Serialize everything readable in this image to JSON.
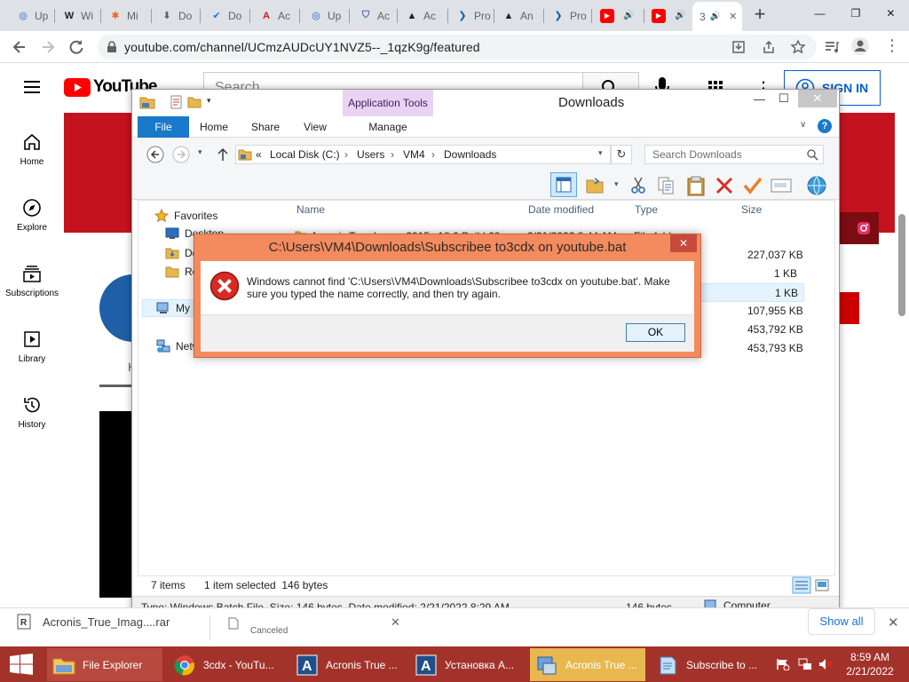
{
  "chrome": {
    "tabs": [
      {
        "label": "Up",
        "icon": "upwork-icon",
        "color": "#1f57c3",
        "glyph": "◎"
      },
      {
        "label": "Wi",
        "icon": "wikipedia-icon",
        "color": "#202124",
        "glyph": "W"
      },
      {
        "label": "Mi",
        "icon": "joomla-icon",
        "color": "#f26522",
        "glyph": "✱"
      },
      {
        "label": "Do",
        "icon": "download-icon",
        "color": "#5f6368",
        "glyph": "⬇"
      },
      {
        "label": "Do",
        "icon": "check-icon",
        "color": "#1a73e8",
        "glyph": "✔"
      },
      {
        "label": "Ac",
        "icon": "acrobat-icon",
        "color": "#e0161d",
        "glyph": "A"
      },
      {
        "label": "Up",
        "icon": "upwork-icon",
        "color": "#1f57c3",
        "glyph": "◎"
      },
      {
        "label": "Ac",
        "icon": "shield-icon",
        "color": "#4a6fa5",
        "glyph": "⛉"
      },
      {
        "label": "Ac",
        "icon": "acronis-icon",
        "color": "#202124",
        "glyph": "▲"
      },
      {
        "label": "Pro",
        "icon": "arrow-icon",
        "color": "#0b5ea8",
        "glyph": "❯"
      },
      {
        "label": "An",
        "icon": "acronis-icon",
        "color": "#202124",
        "glyph": "▲"
      },
      {
        "label": "Pro",
        "icon": "arrow-icon",
        "color": "#0b5ea8",
        "glyph": "❯"
      },
      {
        "label": "",
        "icon": "youtube-icon",
        "color": "#ff0000",
        "glyph": "▶",
        "audio": "🔊"
      },
      {
        "label": "",
        "icon": "youtube-icon",
        "color": "#ff0000",
        "glyph": "▶",
        "audio": "🔊"
      },
      {
        "label": "3",
        "icon": "youtube-icon",
        "color": "#ff0000",
        "glyph": "",
        "audio": "🔊",
        "active": true
      }
    ],
    "close_glyph": "✕",
    "new_tab_glyph": "+",
    "window_controls": [
      "—",
      "❐",
      "✕"
    ],
    "url": "youtube.com/channel/UCmzAUDcUY1NVZ5--_1qzK9g/featured"
  },
  "youtube": {
    "logo_text": "YouTube",
    "search_placeholder": "Search",
    "sign_in": "SIGN IN",
    "nav": [
      {
        "label": "Home",
        "icon": "home-icon"
      },
      {
        "label": "Explore",
        "icon": "compass-icon"
      },
      {
        "label": "Subscriptions",
        "icon": "subscriptions-icon"
      },
      {
        "label": "Library",
        "icon": "library-icon"
      },
      {
        "label": "History",
        "icon": "history-icon"
      }
    ],
    "partial_h": "H"
  },
  "explorer": {
    "title": "Downloads",
    "app_tools": "Application Tools",
    "tabs": [
      "File",
      "Home",
      "Share",
      "View",
      "Manage"
    ],
    "address": {
      "prefix": "«",
      "crumbs": [
        "Local Disk (C:)",
        "Users",
        "VM4",
        "Downloads"
      ]
    },
    "search_placeholder": "Search Downloads",
    "columns": [
      "Name",
      "Date modified",
      "Type",
      "Size"
    ],
    "nav": {
      "favorites": "Favorites",
      "desktop": "Desktop",
      "downloads": "Do",
      "recent": "Re",
      "my_computer": "My",
      "network": "Netw"
    },
    "rows": [
      {
        "name": "Acronis True Image 2015 v18.0 Build 60...",
        "date": "2/21/2022 8:44 AM",
        "type": "File folder",
        "size": ""
      },
      {
        "name": "",
        "date": "",
        "type": "",
        "size": "227,037 KB"
      },
      {
        "name": "",
        "date": "",
        "type": "h File",
        "size": "1 KB"
      },
      {
        "name": "",
        "date": "",
        "type": "h File",
        "size": "1 KB",
        "selected": true
      },
      {
        "name": "",
        "date": "",
        "type": "",
        "size": "107,955 KB"
      },
      {
        "name": "",
        "date": "",
        "type": "mag...",
        "size": "453,792 KB"
      },
      {
        "name": "",
        "date": "",
        "type": "",
        "size": "453,793 KB"
      }
    ],
    "status": {
      "items": "7 items",
      "selected": "1 item selected  146 bytes"
    },
    "detail": {
      "info": "Type: Windows Batch File, Size: 146 bytes, Date modified: 2/21/2022 8:29 AM",
      "size": "146 bytes",
      "location": "Computer"
    }
  },
  "dialog": {
    "title": "C:\\Users\\VM4\\Downloads\\Subscribee to3cdx on youtube.bat",
    "message_line1": "Windows cannot find 'C:\\Users\\VM4\\Downloads\\Subscribee to3cdx on youtube.bat'. Make",
    "message_line2": "sure you typed the name correctly, and then try again.",
    "ok": "OK",
    "close_glyph": "✕"
  },
  "downloads_bar": {
    "file1": "Acronis_True_Imag....rar",
    "file2_status": "Canceled",
    "show_all": "Show all"
  },
  "taskbar": {
    "items": [
      {
        "label": "File Explorer",
        "icon": "folder-icon"
      },
      {
        "label": "3cdx - YouTu...",
        "icon": "chrome-icon"
      },
      {
        "label": "Acronis True ...",
        "icon": "acronis-icon"
      },
      {
        "label": "Установка А...",
        "icon": "acronis-icon"
      },
      {
        "label": "Acronis True ...",
        "icon": "installer-icon"
      },
      {
        "label": "Subscribe to ...",
        "icon": "notepad-icon"
      }
    ],
    "time": "8:59 AM",
    "date": "2/21/2022"
  }
}
